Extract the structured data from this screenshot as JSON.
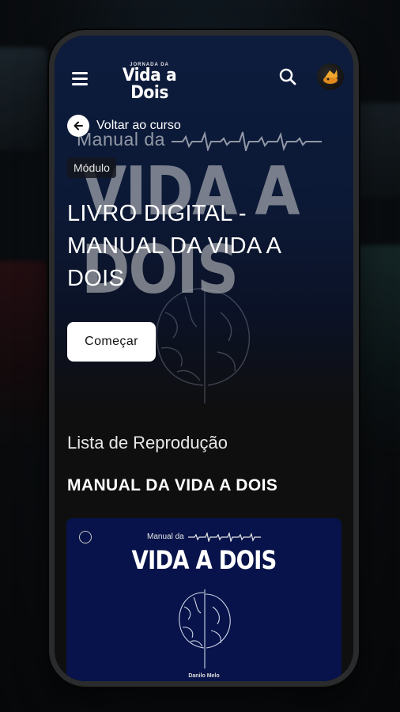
{
  "app": {
    "brand_small": "JORNADA DA",
    "brand_main": "Vida a Dois"
  },
  "icons": {
    "menu": "menu-icon",
    "search": "search-icon",
    "back": "arrow-left-icon"
  },
  "hero": {
    "back_label": "Voltar ao curso",
    "watermark_small": "Manual da",
    "watermark_big": "VIDA A DOIS",
    "badge": "Módulo",
    "title": "LIVRO DIGITAL - MANUAL DA VIDA A DOIS",
    "start_label": "Começar"
  },
  "playlist": {
    "heading": "Lista de Reprodução",
    "section_title": "MANUAL DA VIDA A DOIS",
    "items": [
      {
        "cover_subtitle": "Manual da",
        "cover_title": "VIDA A DOIS",
        "cover_author": "Danilo Melo"
      }
    ]
  },
  "colors": {
    "hero_blue": "#0d1c3d",
    "card_blue": "#07134a",
    "background": "#0f0f10",
    "button_bg": "#ffffff"
  }
}
